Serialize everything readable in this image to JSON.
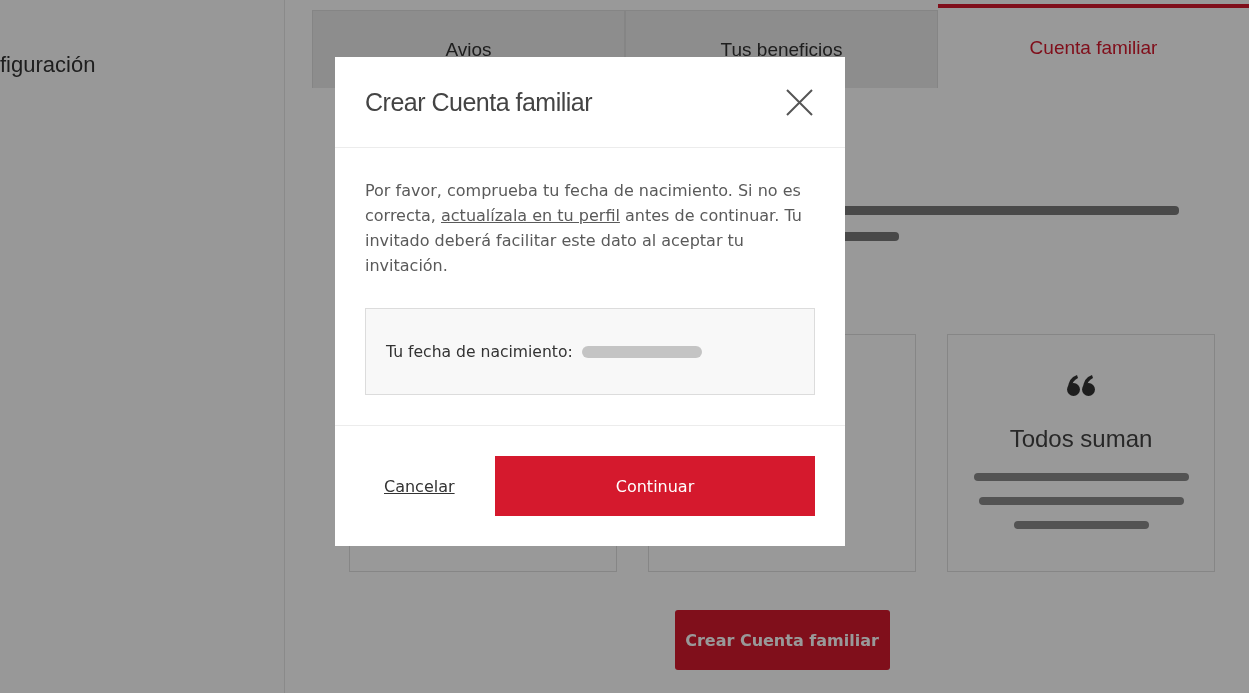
{
  "background": {
    "sidebar": {
      "items": [
        {
          "label": "figuración"
        }
      ]
    },
    "tabs": [
      {
        "label": "Avios",
        "selected": false
      },
      {
        "label": "Tus beneficios",
        "selected": false
      },
      {
        "label": "Cuenta familiar",
        "selected": true
      }
    ],
    "cards": [
      {
        "title": "Todos suman"
      }
    ],
    "button": "Crear Cuenta familiar"
  },
  "dialog": {
    "title": "Crear Cuenta familiar",
    "message": {
      "before": "Por favor, comprueba tu fecha de nacimiento. Si no es correcta, ",
      "link": "actualízala en tu perfil",
      "after": " antes de continuar. Tu invitado deberá facilitar este dato al aceptar tu invitación."
    },
    "birth_date": {
      "label": "Tu fecha de nacimiento:",
      "redacted": true
    },
    "buttons": [
      {
        "label": "Cancelar",
        "kind": "link"
      },
      {
        "label": "Continuar",
        "kind": "primary"
      }
    ]
  }
}
